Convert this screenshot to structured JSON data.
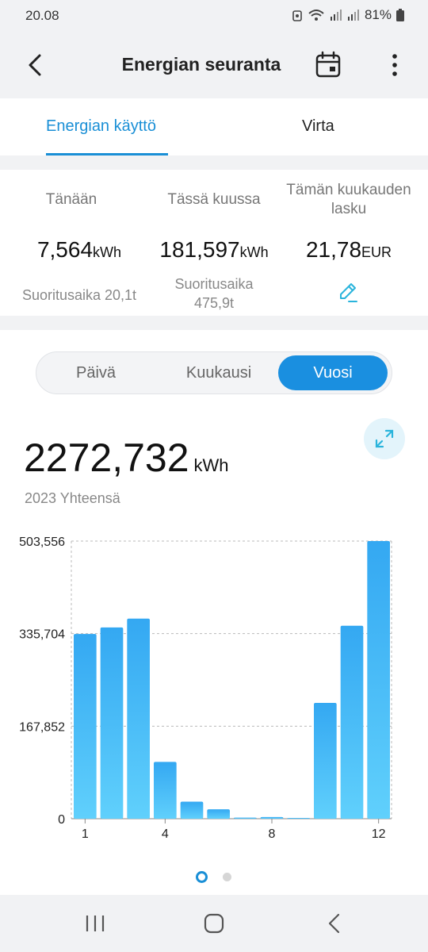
{
  "status": {
    "time": "20.08",
    "battery": "81%"
  },
  "header": {
    "title": "Energian seuranta"
  },
  "tabs": [
    {
      "label": "Energian käyttö"
    },
    {
      "label": "Virta"
    }
  ],
  "stats": {
    "today": {
      "label": "Tänään",
      "value": "7,564",
      "unit": "kWh",
      "sub": "Suoritusaika 20,1t"
    },
    "month": {
      "label": "Tässä kuussa",
      "value": "181,597",
      "unit": "kWh",
      "sub_line1": "Suoritusaika",
      "sub_line2": "475,9t"
    },
    "bill": {
      "label_line1": "Tämän kuukauden",
      "label_line2": "lasku",
      "value": "21,78",
      "unit": "EUR"
    }
  },
  "period": {
    "options": [
      "Päivä",
      "Kuukausi",
      "Vuosi"
    ],
    "selected": "Vuosi"
  },
  "total": {
    "value": "2272,732",
    "unit": "kWh",
    "label": "2023 Yhteensä"
  },
  "chart_data": {
    "type": "bar",
    "categories": [
      1,
      2,
      3,
      4,
      5,
      6,
      7,
      8,
      9,
      10,
      11,
      12
    ],
    "x_tick_labels": [
      "1",
      "4",
      "8",
      "12"
    ],
    "values": [
      335,
      347,
      363,
      103,
      31,
      17,
      2,
      3,
      1,
      210,
      350,
      503.556
    ],
    "y_ticks": [
      0,
      167.852,
      335.704,
      503.556
    ],
    "y_tick_labels": [
      "0",
      "167,852",
      "335,704",
      "503,556"
    ],
    "ylim": [
      0,
      503.556
    ],
    "bar_color_top": "#34a8f2",
    "bar_color_bottom": "#60d0fc"
  },
  "pager": {
    "pages": 2,
    "current": 1
  },
  "colors": {
    "accent": "#1a8fd6",
    "background": "#f1f2f4"
  },
  "icons": {
    "back": "arrow-left-icon",
    "calendar": "calendar-icon",
    "more": "more-vertical-icon",
    "edit": "pencil-icon",
    "expand": "expand-icon",
    "nav_recent": "recent-apps-icon",
    "nav_home": "home-icon",
    "nav_back": "back-icon"
  }
}
